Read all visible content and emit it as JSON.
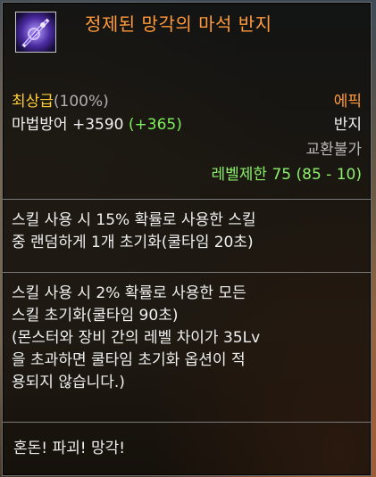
{
  "item": {
    "name": "정제된 망각의 마석 반지",
    "grade_label": "최상급",
    "grade_percent": "(100%)",
    "rarity": "에픽",
    "stat_name": "마법방어",
    "stat_value": "+3590",
    "stat_bonus": "(+365)",
    "type": "반지",
    "trade_status": "교환불가",
    "level_req": "레벨제한 75 (85 - 10)"
  },
  "options": [
    {
      "lines": [
        "스킬 사용 시 15% 확률로 사용한 스킬",
        "중 랜덤하게 1개 초기화(쿨타임 20초)"
      ]
    },
    {
      "lines": [
        "스킬 사용 시 2% 확률로 사용한 모든",
        "스킬 초기화(쿨타임 90초)",
        "(몬스터와 장비 간의 레벨 차이가 35Lv",
        "을 초과하면 쿨타임 초기화 옵션이 적",
        "용되지 않습니다.)"
      ]
    }
  ],
  "flavor_text": "혼돈! 파괴! 망각!",
  "colors": {
    "title": "#ff9a3c",
    "grade": "#ffcc33",
    "bonus": "#7cf05a",
    "level": "#8cf06a"
  },
  "icons": {
    "item": "ring-of-oblivion-icon"
  }
}
